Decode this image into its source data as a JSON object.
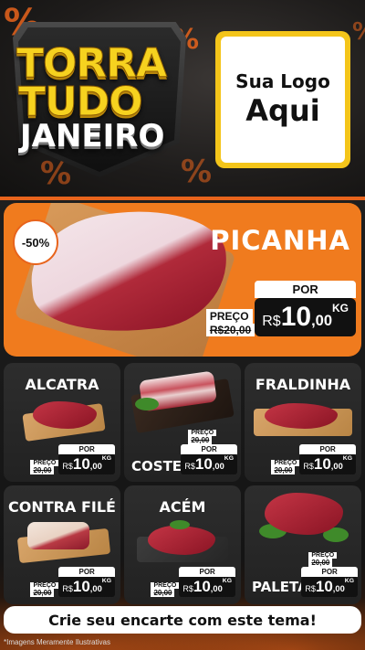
{
  "header": {
    "title_line1": "TORRA",
    "title_line2": "TUDO",
    "title_line3": "JANEIRO",
    "logo_line1": "Sua Logo",
    "logo_line2": "Aqui",
    "percent_symbol": "%"
  },
  "featured": {
    "name": "PICANHA",
    "discount": "-50%",
    "preco_label": "PREÇO",
    "old_price": "R$20,00",
    "por_label": "POR",
    "currency": "R$",
    "price_int": "10",
    "price_dec": ",00",
    "unit": "KG"
  },
  "products": [
    {
      "name": "ALCATRA",
      "preco_label": "PREÇO",
      "old_price": "20,00",
      "por_label": "POR",
      "currency": "R$",
      "price_int": "10",
      "price_dec": ",00",
      "unit": "KG"
    },
    {
      "name": "COSTELA",
      "preco_label": "PREÇO",
      "old_price": "20,00",
      "por_label": "POR",
      "currency": "R$",
      "price_int": "10",
      "price_dec": ",00",
      "unit": "KG"
    },
    {
      "name": "FRALDINHA",
      "preco_label": "PREÇO",
      "old_price": "20,00",
      "por_label": "POR",
      "currency": "R$",
      "price_int": "10",
      "price_dec": ",00",
      "unit": "KG"
    },
    {
      "name": "CONTRA FILÉ",
      "preco_label": "PREÇO",
      "old_price": "20,00",
      "por_label": "POR",
      "currency": "R$",
      "price_int": "10",
      "price_dec": ",00",
      "unit": "KG"
    },
    {
      "name": "ACÉM",
      "preco_label": "PREÇO",
      "old_price": "20,00",
      "por_label": "POR",
      "currency": "R$",
      "price_int": "10",
      "price_dec": ",00",
      "unit": "KG"
    },
    {
      "name": "PALETA",
      "preco_label": "PREÇO",
      "old_price": "20,00",
      "por_label": "POR",
      "currency": "R$",
      "price_int": "10",
      "price_dec": ",00",
      "unit": "KG"
    }
  ],
  "cta_text": "Crie seu encarte com este tema!",
  "disclaimer": "*Imagens Meramente Ilustrativas",
  "colors": {
    "accent": "#e8641c",
    "hero_bg": "#f07b1e",
    "title_yellow": "#f6d21f",
    "logo_frame": "#f4c51a",
    "card_bg": "#2a2a2a"
  }
}
